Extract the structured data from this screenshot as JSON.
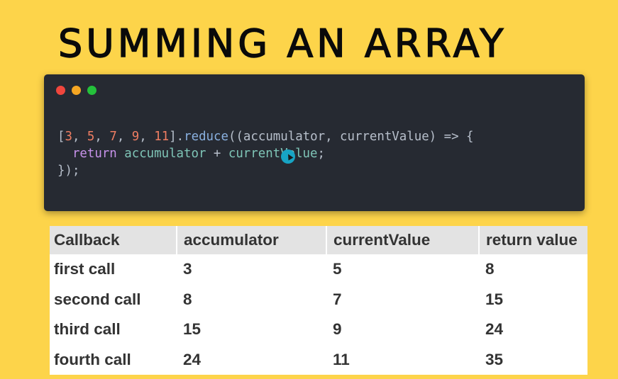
{
  "slide": {
    "title": "SUMMING AN ARRAY"
  },
  "code_window": {
    "dots": [
      "red",
      "yellow",
      "green"
    ],
    "lines": {
      "line1": {
        "open_bracket": "[",
        "n1": "3",
        "n2": "5",
        "n3": "7",
        "n4": "9",
        "n5": "11",
        "sep": ", ",
        "close_bracket": "].",
        "method": "reduce",
        "params": "((accumulator, currentValue) => {"
      },
      "line2": {
        "indent": "  ",
        "keyword": "return",
        "expr_a": "accumulator",
        "plus": " + ",
        "expr_b": "currentValue",
        "semi": ";"
      },
      "line3": "});"
    }
  },
  "table": {
    "headers": [
      "Callback",
      "accumulator",
      "currentValue",
      "return value"
    ],
    "rows": [
      [
        "first call",
        "3",
        "5",
        "8"
      ],
      [
        "second call",
        "8",
        "7",
        "15"
      ],
      [
        "third call",
        "15",
        "9",
        "24"
      ],
      [
        "fourth call",
        "24",
        "11",
        "35"
      ]
    ]
  },
  "colors": {
    "background": "#fdd44a",
    "editor": "#262a32",
    "number": "#ee7d62",
    "keyword": "#c792ea",
    "identifier": "#7fc5b7",
    "cursor": "#17a4c4"
  }
}
